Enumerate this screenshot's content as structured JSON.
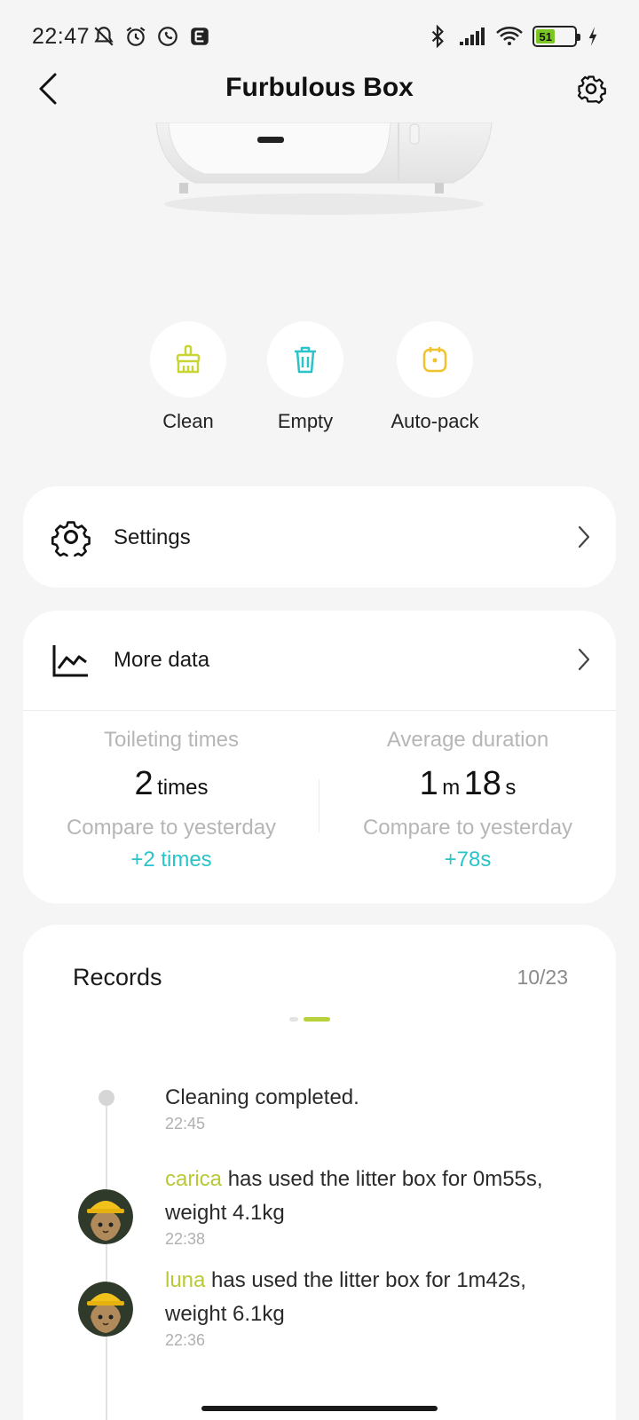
{
  "status_bar": {
    "time": "22:47",
    "battery": "51",
    "icons_left": [
      "mute-icon",
      "alarm-icon",
      "whatsapp-icon",
      "app-icon"
    ],
    "icons_right": [
      "bluetooth-icon",
      "signal-icon",
      "wifi-icon",
      "battery-icon",
      "charging-icon"
    ]
  },
  "header": {
    "title": "Furbulous Box"
  },
  "actions": [
    {
      "label": "Clean",
      "icon": "broom-icon",
      "color": "#c9d534"
    },
    {
      "label": "Empty",
      "icon": "trash-icon",
      "color": "#2ac3c8"
    },
    {
      "label": "Auto-pack",
      "icon": "pack-icon",
      "color": "#f0c22c"
    }
  ],
  "settings_row": {
    "label": "Settings"
  },
  "more_data": {
    "label": "More data",
    "toileting": {
      "label": "Toileting times",
      "value": "2",
      "unit": "times",
      "compare_label": "Compare to yesterday",
      "delta": "+2 times"
    },
    "duration": {
      "label": "Average duration",
      "minutes": "1",
      "minutes_unit": "m",
      "seconds": "18",
      "seconds_unit": "s",
      "compare_label": "Compare to yesterday",
      "delta": "+78s"
    }
  },
  "records": {
    "title": "Records",
    "count": "10/23",
    "items": [
      {
        "text": "Cleaning completed.",
        "time": "22:45"
      },
      {
        "name": "carica",
        "text": " has used the litter box for 0m55s, weight 4.1kg",
        "time": "22:38"
      },
      {
        "name": "luna",
        "text": " has used the litter box for 1m42s, weight 6.1kg",
        "time": "22:36"
      }
    ]
  },
  "colors": {
    "accent_teal": "#2ac3c8",
    "accent_lime": "#b9c834",
    "background": "#f5f5f5"
  }
}
